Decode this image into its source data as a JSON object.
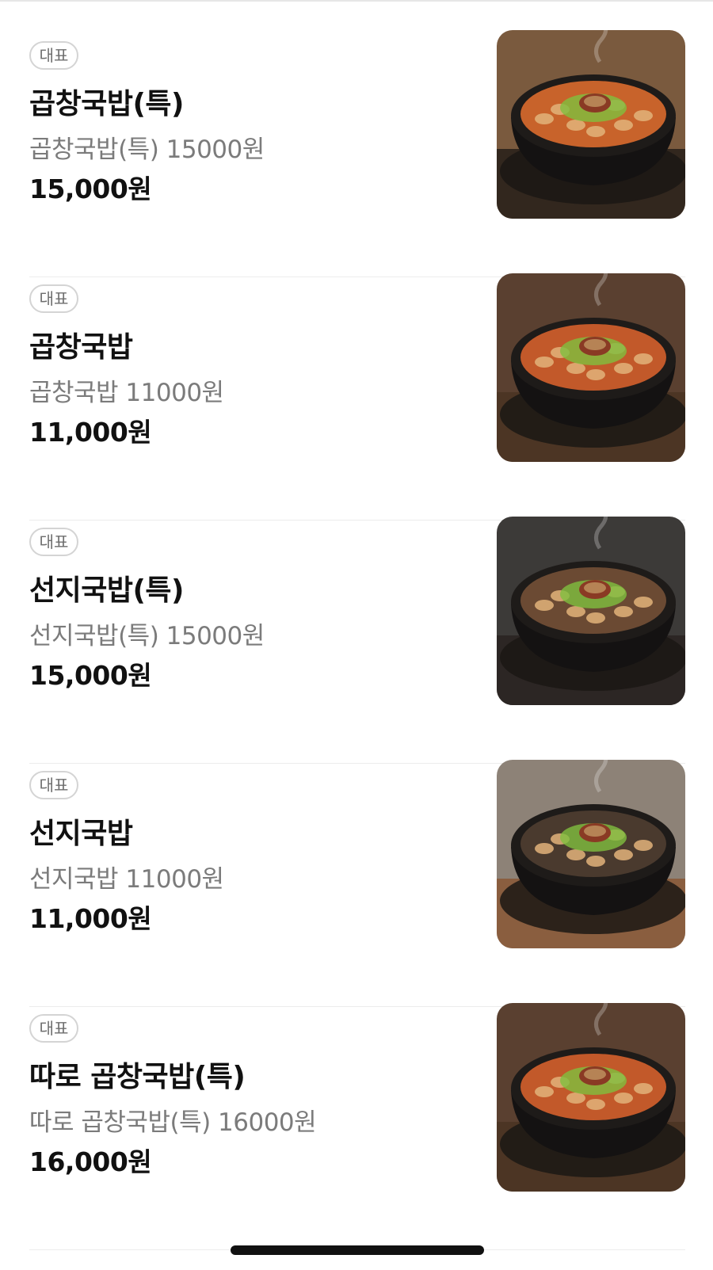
{
  "menu": {
    "items": [
      {
        "badge": "대표",
        "name": "곱창국밥(특)",
        "description": "곱창국밥(특) 15000원",
        "price": "15,000원",
        "image_icon": "gopchang-gukbap-photo",
        "background": "#7a5a3e",
        "table": "#2a211b",
        "broth": "#c8632b"
      },
      {
        "badge": "대표",
        "name": "곱창국밥",
        "description": "곱창국밥 11000원",
        "price": "11,000원",
        "image_icon": "gopchang-gukbap-photo",
        "background": "#5a4030",
        "table": "#4a3424",
        "broth": "#c2592a"
      },
      {
        "badge": "대표",
        "name": "선지국밥(특)",
        "description": "선지국밥(특) 15000원",
        "price": "15,000원",
        "image_icon": "seonji-gukbap-photo",
        "background": "#3c3a38",
        "table": "#2a2522",
        "broth": "#6b4a33"
      },
      {
        "badge": "대표",
        "name": "선지국밥",
        "description": "선지국밥 11000원",
        "price": "11,000원",
        "image_icon": "seonji-gukbap-photo",
        "background": "#8d8277",
        "table": "#8a5a38",
        "broth": "#4a3a2e"
      },
      {
        "badge": "대표",
        "name": "따로 곱창국밥(특)",
        "description": "따로 곱창국밥(특) 16000원",
        "price": "16,000원",
        "image_icon": "ttaro-gopchang-gukbap-photo",
        "background": "#5a4030",
        "table": "#4a3424",
        "broth": "#c2592a"
      }
    ]
  }
}
